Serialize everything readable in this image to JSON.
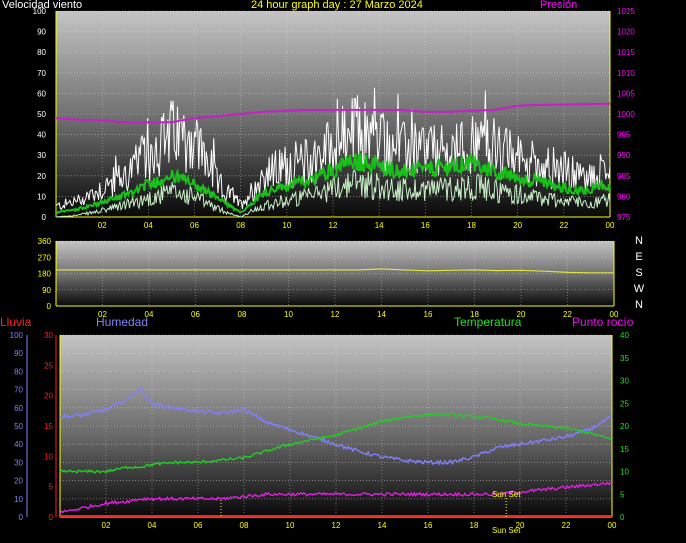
{
  "header": {
    "left": "Velocidad viento",
    "center": "24 hour graph day : 27 Marzo 2024",
    "right": "Presión"
  },
  "colors": {
    "wind": "#ffffff",
    "wind_avg": "#19c019",
    "wind_min": "#c8f0c8",
    "pressure": "#c81ec8",
    "direction": "#e0e040",
    "rain": "#ff2020",
    "humidity": "#8080ff",
    "temperature": "#20d020",
    "dewpoint": "#e020e0",
    "axis_left_top": "#ffffff",
    "axis_right_top": "#ff00ff",
    "axis_yellow": "#ffff00",
    "axis_blue": "#8080ff",
    "axis_red": "#ff2020",
    "axis_green": "#20e020"
  },
  "x_ticks": [
    "02",
    "04",
    "06",
    "08",
    "10",
    "12",
    "14",
    "16",
    "18",
    "20",
    "22",
    "00"
  ],
  "chart_data": [
    {
      "type": "line",
      "name": "wind-pressure",
      "x": [
        0,
        1,
        2,
        3,
        4,
        5,
        6,
        7,
        8,
        9,
        10,
        11,
        12,
        13,
        14,
        15,
        16,
        17,
        18,
        19,
        20,
        21,
        22,
        23,
        24
      ],
      "ylim": [
        0,
        100
      ],
      "y_ticks": [
        0,
        10,
        20,
        30,
        40,
        50,
        60,
        70,
        80,
        90,
        100
      ],
      "y2lim": [
        975,
        1025
      ],
      "y2_ticks": [
        975,
        980,
        985,
        990,
        995,
        1000,
        1005,
        1010,
        1015,
        1020,
        1025
      ],
      "series": [
        {
          "key": "gust",
          "values": [
            5,
            8,
            14,
            20,
            30,
            40,
            38,
            16,
            6,
            20,
            25,
            27,
            35,
            42,
            38,
            32,
            33,
            30,
            36,
            33,
            28,
            26,
            22,
            18,
            24
          ]
        },
        {
          "key": "average",
          "values": [
            2,
            4,
            7,
            11,
            16,
            20,
            16,
            9,
            2,
            12,
            15,
            18,
            23,
            27,
            25,
            22,
            23,
            24,
            26,
            22,
            19,
            17,
            14,
            13,
            16
          ]
        },
        {
          "key": "minimum",
          "values": [
            0,
            1,
            3,
            6,
            9,
            12,
            10,
            4,
            0,
            6,
            8,
            10,
            14,
            17,
            15,
            13,
            14,
            14,
            15,
            13,
            11,
            9,
            8,
            7,
            8
          ]
        },
        {
          "key": "pressure",
          "axis": "y2",
          "values": [
            999,
            998.6,
            998.5,
            998.0,
            998.0,
            998.0,
            999.0,
            999.5,
            1000,
            1000.5,
            1000.8,
            1001,
            1001,
            1001,
            1001,
            1001,
            1000.5,
            1000.5,
            1000.8,
            1001,
            1002,
            1002.2,
            1002.3,
            1002.4,
            1002.5
          ]
        }
      ]
    },
    {
      "type": "line",
      "name": "wind-direction",
      "x": [
        0,
        2,
        4,
        6,
        8,
        10,
        12,
        13,
        14,
        15,
        16,
        17,
        18,
        19,
        20,
        21,
        22,
        23,
        24
      ],
      "ylim": [
        0,
        360
      ],
      "y_ticks": [
        0,
        90,
        180,
        270,
        360
      ],
      "y_ticks_right": [
        "N",
        "E",
        "S",
        "W",
        "N"
      ],
      "series": [
        {
          "key": "direction",
          "values": [
            200,
            200,
            200,
            200,
            200,
            200,
            200,
            200,
            205,
            200,
            195,
            198,
            200,
            196,
            198,
            193,
            186,
            184,
            184
          ]
        }
      ]
    },
    {
      "type": "line",
      "name": "humidity-temperature",
      "x": [
        0,
        1,
        2,
        3,
        3.5,
        4,
        5,
        6,
        7,
        8,
        9,
        10,
        11,
        12,
        13,
        14,
        15,
        16,
        17,
        18,
        19,
        20,
        21,
        22,
        23,
        24
      ],
      "ylim_rain": [
        0,
        30
      ],
      "rain_ticks": [
        0,
        5,
        10,
        15,
        20,
        25,
        30
      ],
      "ylim_humidity": [
        0,
        100
      ],
      "humidity_ticks": [
        0,
        10,
        20,
        30,
        40,
        50,
        60,
        70,
        80,
        90,
        100
      ],
      "ylim_temp": [
        0,
        40
      ],
      "temp_ticks": [
        0,
        5,
        10,
        15,
        20,
        25,
        30,
        35,
        40
      ],
      "series": [
        {
          "key": "humidity",
          "values": [
            55,
            56,
            59,
            65,
            71,
            62,
            60,
            58,
            57,
            59,
            52,
            48,
            44,
            40,
            36,
            33,
            31,
            30,
            30,
            33,
            38,
            40,
            42,
            44,
            48,
            55
          ]
        },
        {
          "key": "temperature",
          "values": [
            10,
            10,
            10,
            11,
            11,
            11.5,
            12,
            12,
            12.5,
            13,
            14.5,
            16,
            17,
            18,
            19.5,
            21,
            22,
            22.5,
            22.5,
            22,
            21.5,
            20.5,
            20,
            19.5,
            18.5,
            17
          ]
        },
        {
          "key": "dewpoint",
          "values": [
            1,
            2,
            3,
            3.5,
            4,
            4,
            4,
            4,
            4,
            4.5,
            5,
            5,
            5,
            5,
            5,
            5,
            5,
            5,
            5,
            5,
            5,
            5.5,
            6,
            6.5,
            7,
            7.5
          ]
        },
        {
          "key": "rain",
          "values": [
            0,
            0,
            0,
            0,
            0,
            0,
            0,
            0,
            0,
            0,
            0,
            0,
            0,
            0,
            0,
            0,
            0,
            0,
            0,
            0,
            0,
            0,
            0,
            0,
            0,
            0
          ]
        }
      ]
    }
  ],
  "humidity_header": {
    "rain": "Lluvia",
    "humidity": "Humedad",
    "temperature": "Temperatura",
    "dewpoint": "Punto rocío"
  },
  "markers": {
    "sunrise_hour": 7.0,
    "sunset_hour": 19.4,
    "sunset_label": "Sun Set"
  }
}
